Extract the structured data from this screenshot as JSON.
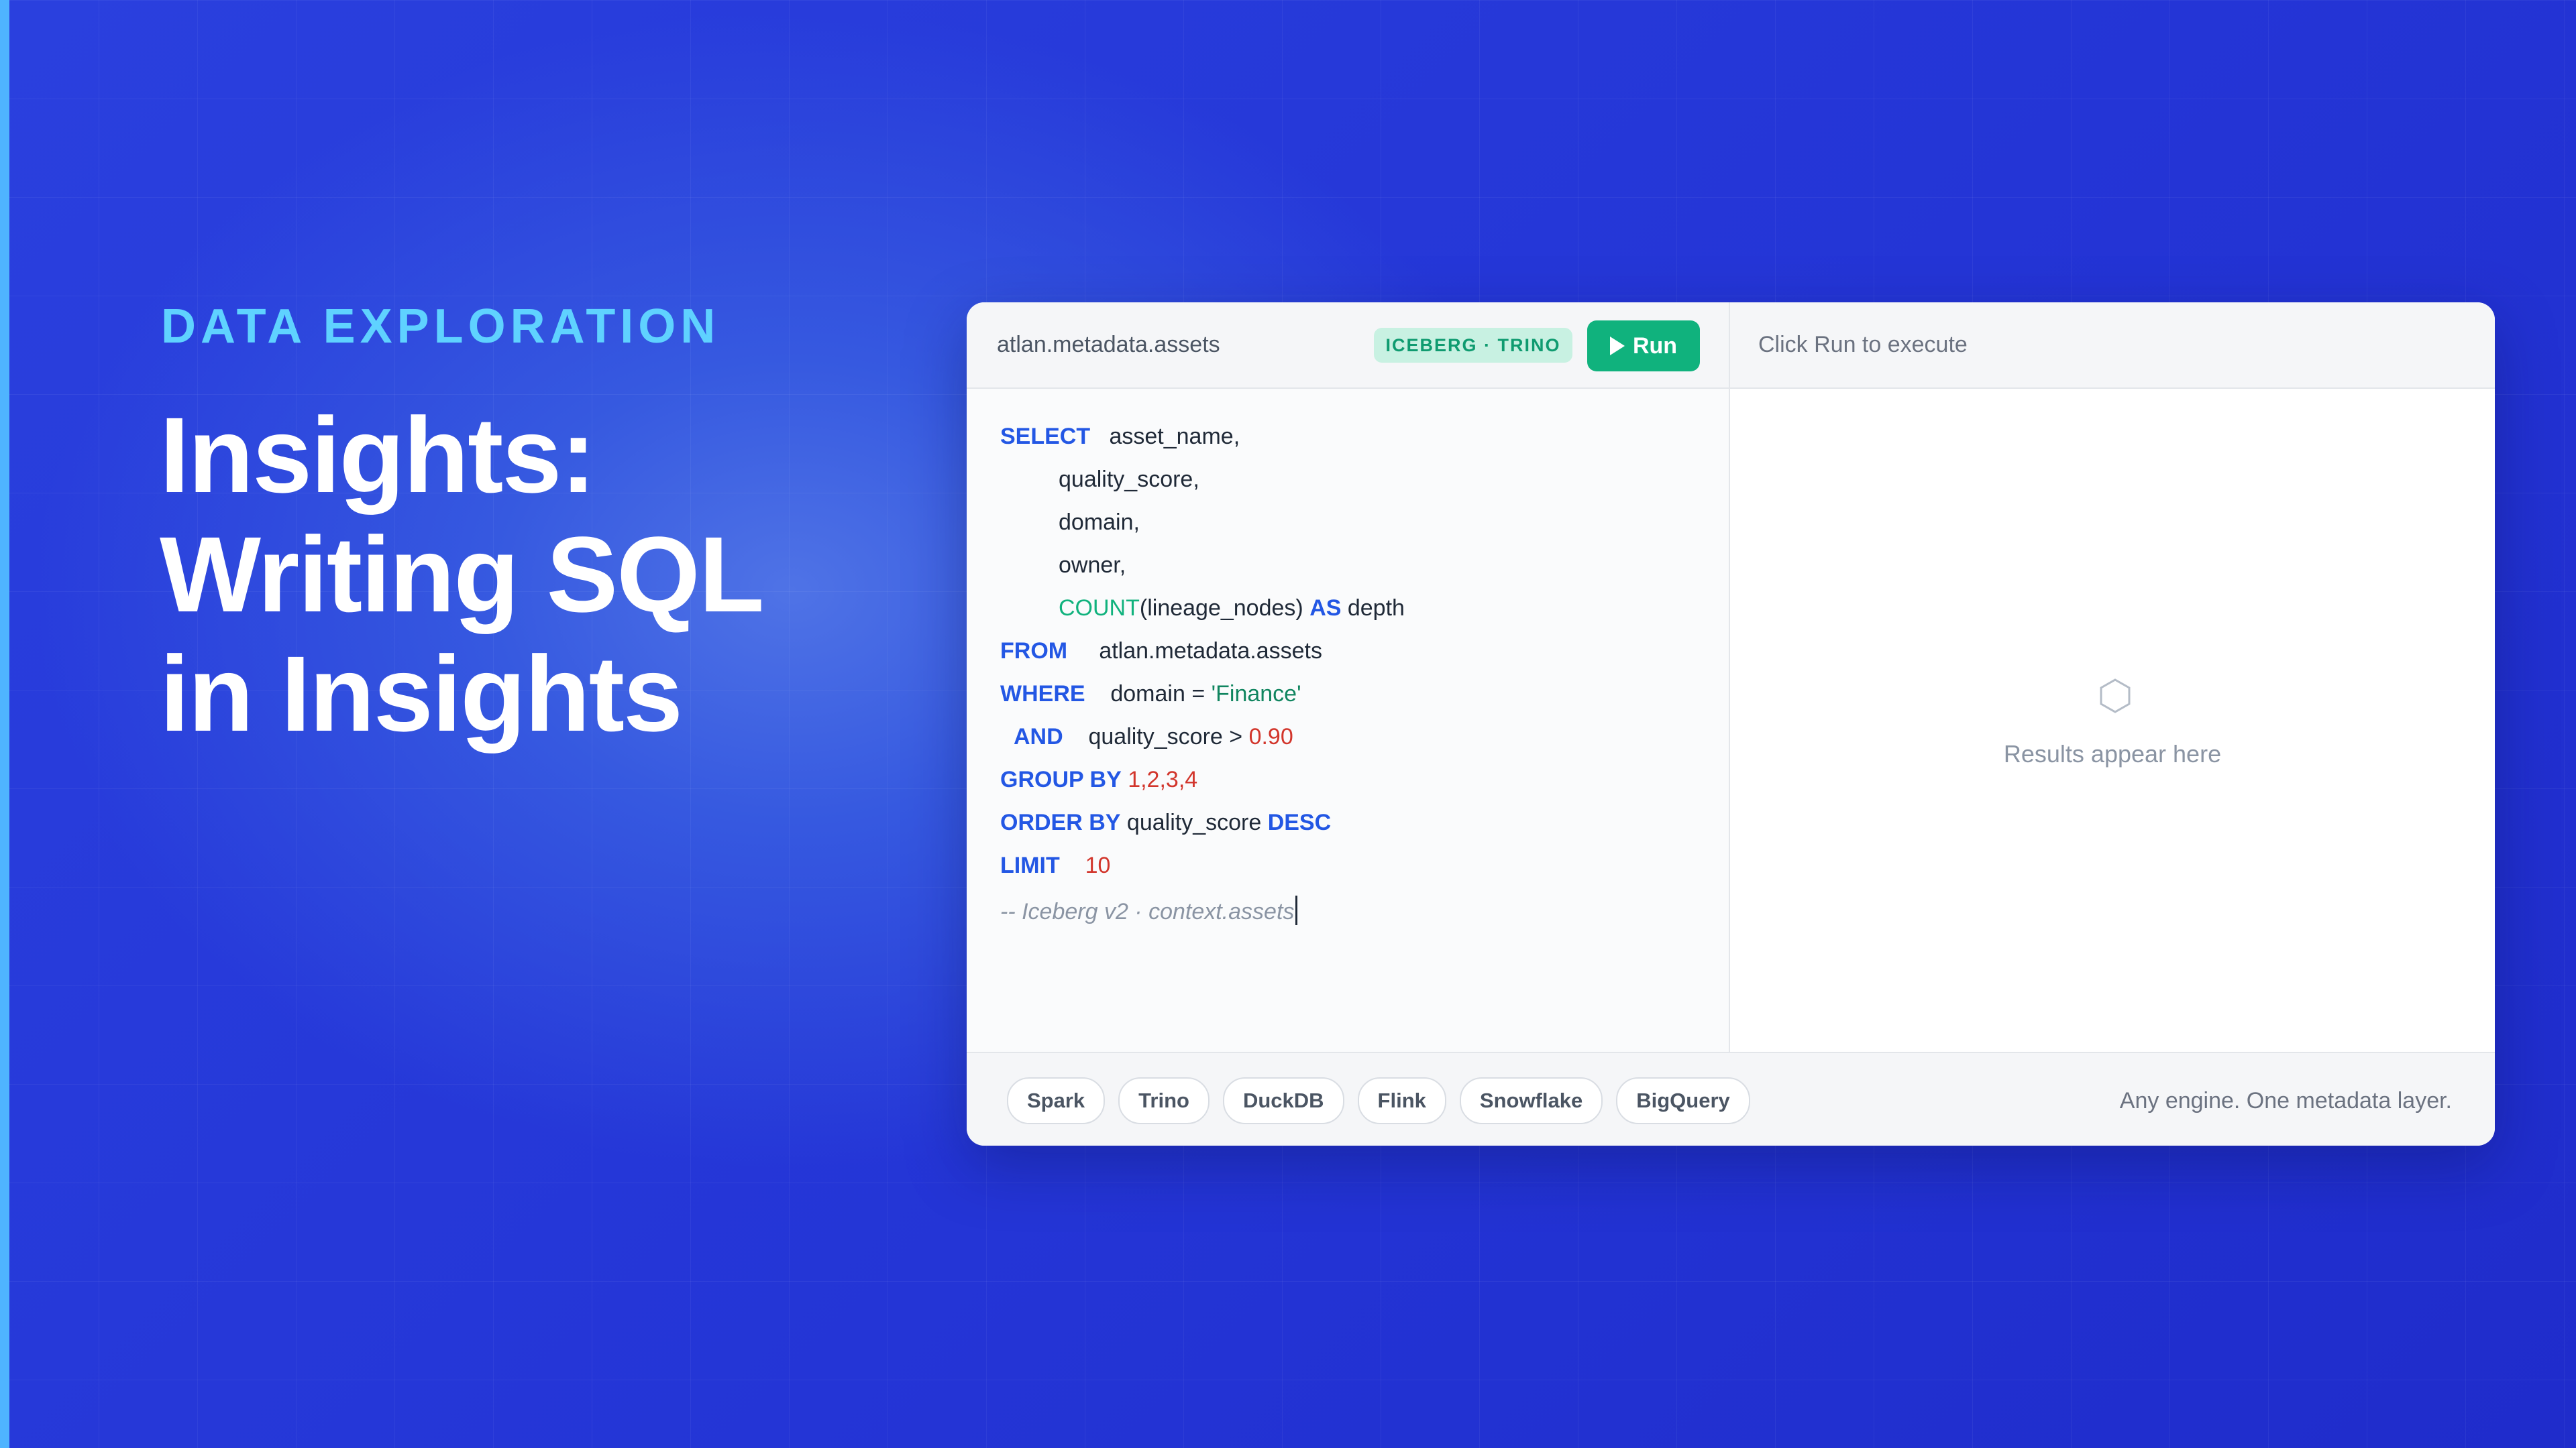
{
  "hero": {
    "eyebrow": "DATA EXPLORATION",
    "headline": [
      "Insights:",
      "Writing SQL",
      "in Insights"
    ]
  },
  "editor_panel": {
    "path": "atlan.metadata.assets",
    "engine_badge": "ICEBERG · TRINO",
    "run_label": "Run",
    "run_hint": "Click Run to execute",
    "code": {
      "l1_kw": "SELECT",
      "l1_rest": "asset_name,",
      "l2": "quality_score,",
      "l3": "domain,",
      "l4": "owner,",
      "l5_fn": "COUNT",
      "l5_mid": "(lineage_nodes) ",
      "l5_kw": "AS",
      "l5_rest": " depth",
      "l6_kw": "FROM",
      "l6_rest": "atlan.metadata.assets",
      "l7_kw": "WHERE",
      "l7_mid": "domain = ",
      "l7_str": "'Finance'",
      "l8_kw": "AND",
      "l8_mid": "quality_score > ",
      "l8_num": "0.90",
      "l9_kw": "GROUP BY",
      "l9_num": "1,2,3,4",
      "l10_kw": "ORDER BY",
      "l10_mid": " quality_score ",
      "l10_kw2": "DESC",
      "l11_kw": "LIMIT",
      "l11_num": "10",
      "l12_comment": "-- Iceberg v2 · context.assets"
    },
    "results_placeholder": "Results appear here",
    "results_icon": "hexagon-icon",
    "engines": [
      "Spark",
      "Trino",
      "DuckDB",
      "Flink",
      "Snowflake",
      "BigQuery"
    ],
    "tagline": "Any engine. One metadata layer."
  },
  "colors": {
    "background": "#2435d6",
    "eyebrow": "#5fd2ff",
    "run_button": "#10b27d",
    "keyword": "#2357e4",
    "function": "#10b27d",
    "string": "#10855f",
    "number": "#d2352b"
  }
}
